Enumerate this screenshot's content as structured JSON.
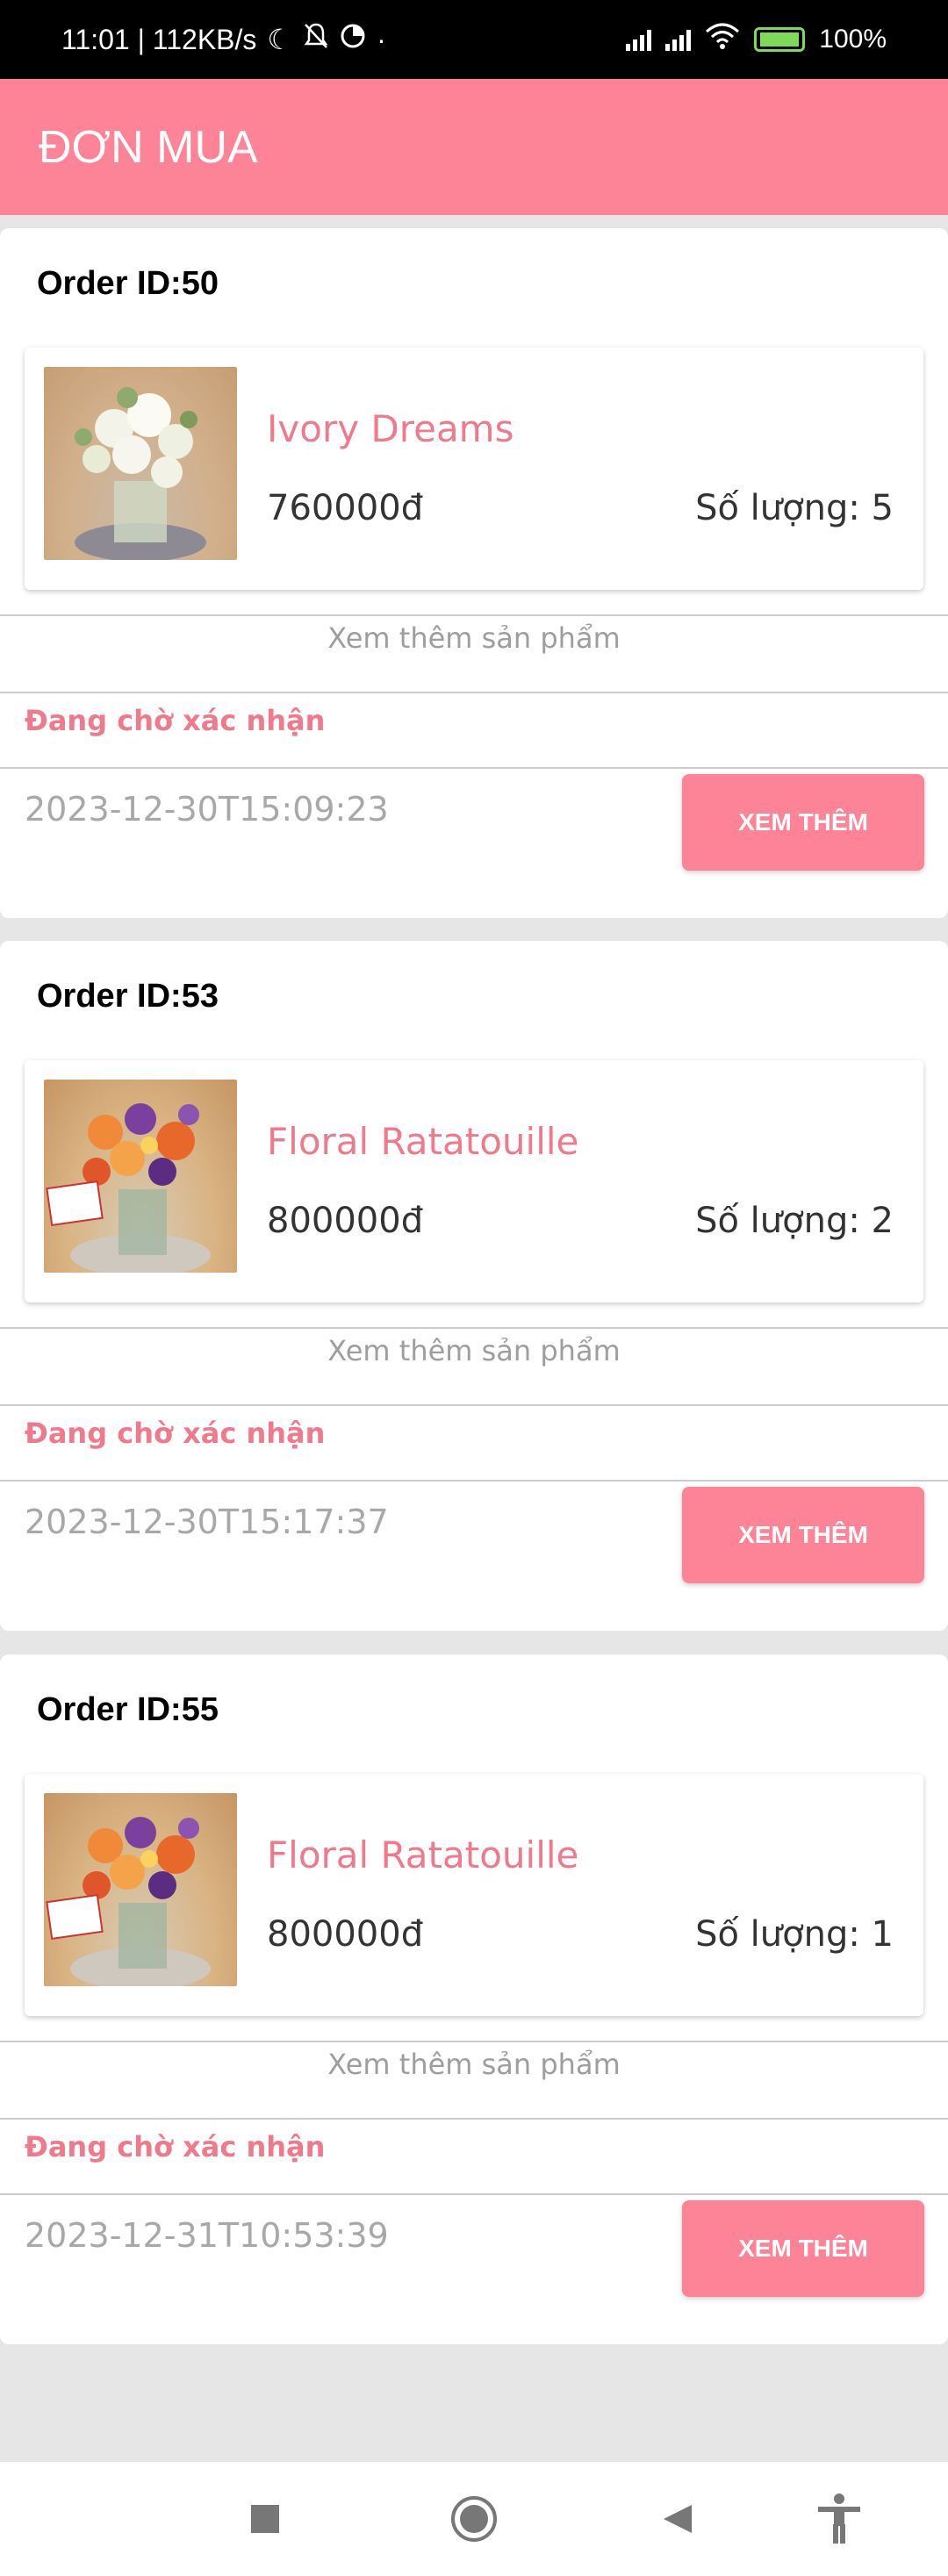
{
  "status_bar": {
    "time_network": "11:01 | 112KB/s",
    "battery": "100%",
    "icons": [
      "moon-icon",
      "bell-off-icon",
      "data-saver-icon",
      "dot-icon",
      "signal-icon",
      "signal-icon",
      "wifi-icon",
      "battery-charging-icon"
    ]
  },
  "app_bar": {
    "title": "ĐƠN MUA",
    "color": "#fd8496"
  },
  "orders": [
    {
      "order_id": "Order ID:50",
      "product": {
        "name": "Ivory Dreams",
        "price": "760000đ",
        "quantity": "Số lượng: 5",
        "image": "ivory-flower-image"
      },
      "more_products": "Xem thêm sản phẩm",
      "status": "Đang chờ xác nhận",
      "date": "2023-12-30T15:09:23",
      "button": "XEM THÊM"
    },
    {
      "order_id": "Order ID:53",
      "product": {
        "name": "Floral Ratatouille",
        "price": "800000đ",
        "quantity": "Số lượng: 2",
        "image": "floral-ratatouille-image"
      },
      "more_products": "Xem thêm sản phẩm",
      "status": "Đang chờ xác nhận",
      "date": "2023-12-30T15:17:37",
      "button": "XEM THÊM"
    },
    {
      "order_id": "Order ID:55",
      "product": {
        "name": "Floral Ratatouille",
        "price": "800000đ",
        "quantity": "Số lượng: 1",
        "image": "floral-ratatouille-image"
      },
      "more_products": "Xem thêm sản phẩm",
      "status": "Đang chờ xác nhận",
      "date": "2023-12-31T10:53:39",
      "button": "XEM THÊM"
    }
  ],
  "nav_bar": {
    "icons": [
      "recents-square-icon",
      "home-circle-icon",
      "back-triangle-icon",
      "accessibility-icon"
    ]
  }
}
